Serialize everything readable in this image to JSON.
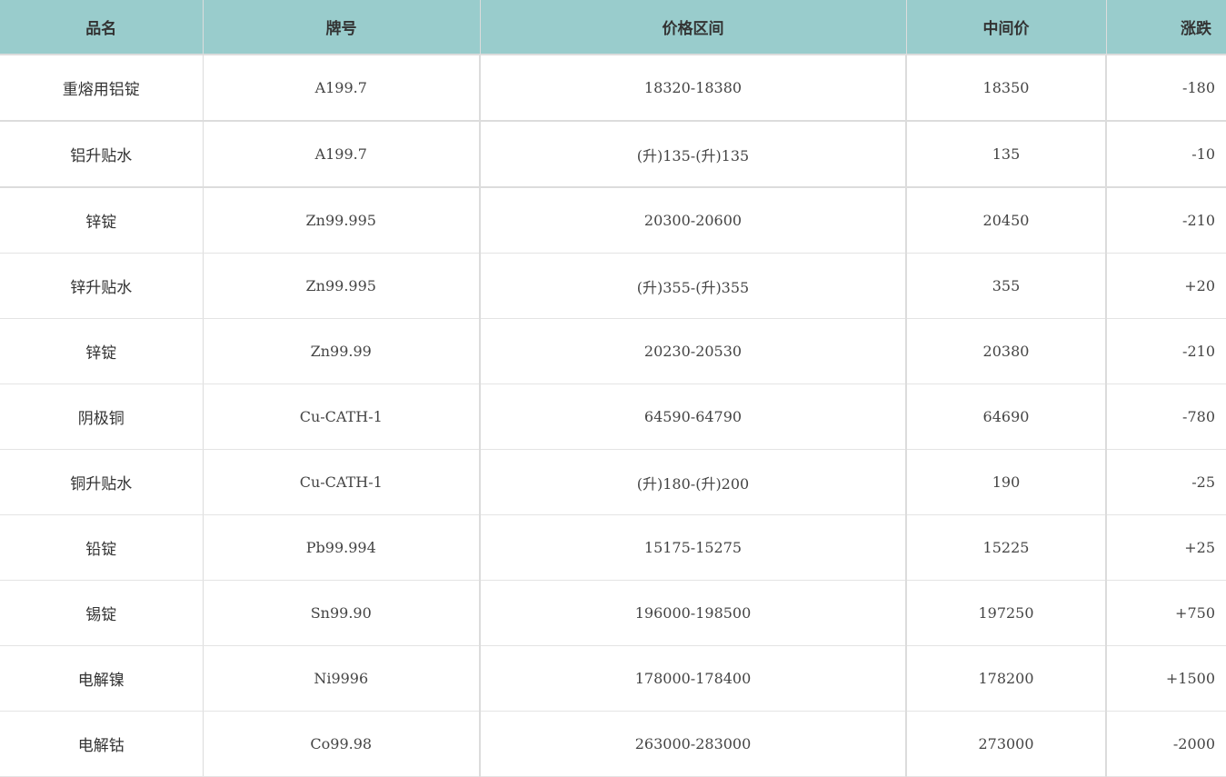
{
  "table": {
    "headers": {
      "name": "品名",
      "grade": "牌号",
      "range": "价格区间",
      "mid": "中间价",
      "change": "涨跌"
    },
    "rows": [
      {
        "name": "重熔用铝锭",
        "grade": "A199.7",
        "range": "18320-18380",
        "mid": "18350",
        "change": "-180"
      },
      {
        "name": "铝升贴水",
        "grade": "A199.7",
        "range": "(升)135-(升)135",
        "mid": "135",
        "change": "-10"
      },
      {
        "name": "锌锭",
        "grade": "Zn99.995",
        "range": "20300-20600",
        "mid": "20450",
        "change": "-210"
      },
      {
        "name": "锌升贴水",
        "grade": "Zn99.995",
        "range": "(升)355-(升)355",
        "mid": "355",
        "change": "+20"
      },
      {
        "name": "锌锭",
        "grade": "Zn99.99",
        "range": "20230-20530",
        "mid": "20380",
        "change": "-210"
      },
      {
        "name": "阴极铜",
        "grade": "Cu-CATH-1",
        "range": "64590-64790",
        "mid": "64690",
        "change": "-780"
      },
      {
        "name": "铜升贴水",
        "grade": "Cu-CATH-1",
        "range": "(升)180-(升)200",
        "mid": "190",
        "change": "-25"
      },
      {
        "name": "铅锭",
        "grade": "Pb99.994",
        "range": "15175-15275",
        "mid": "15225",
        "change": "+25"
      },
      {
        "name": "锡锭",
        "grade": "Sn99.90",
        "range": "196000-198500",
        "mid": "197250",
        "change": "+750"
      },
      {
        "name": "电解镍",
        "grade": "Ni9996",
        "range": "178000-178400",
        "mid": "178200",
        "change": "+1500"
      },
      {
        "name": "电解钴",
        "grade": "Co99.98",
        "range": "263000-283000",
        "mid": "273000",
        "change": "-2000"
      }
    ]
  },
  "colors": {
    "header_bg": "#99cccc",
    "text": "#333333",
    "grid": "#dcdcdc"
  }
}
